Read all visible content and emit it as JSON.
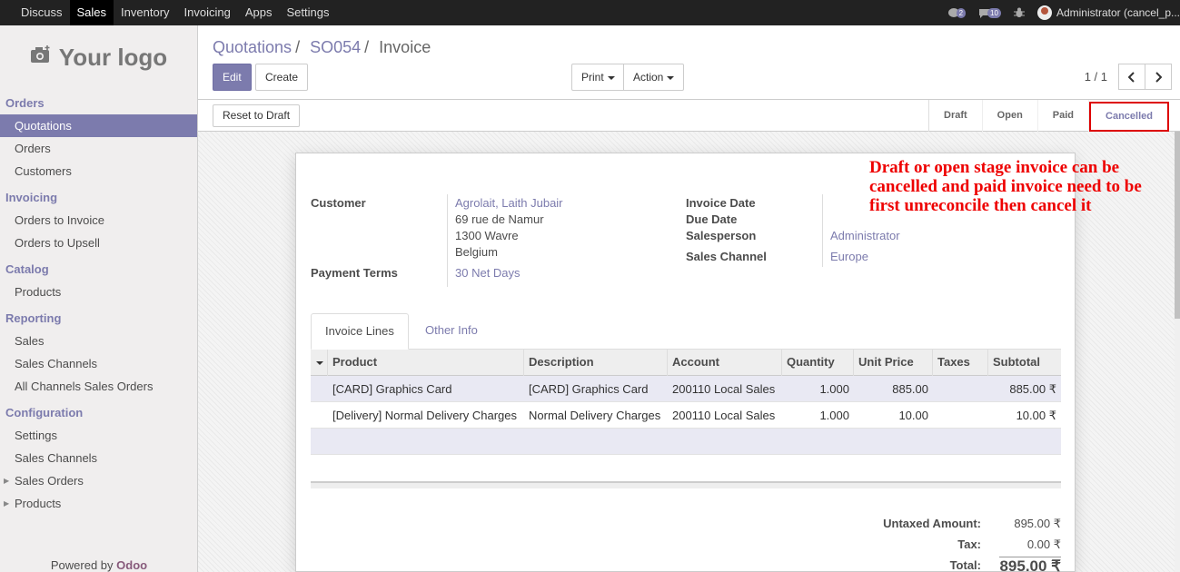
{
  "topbar": {
    "menu": [
      "Discuss",
      "Sales",
      "Inventory",
      "Invoicing",
      "Apps",
      "Settings"
    ],
    "active_menu": "Sales",
    "chat_count": "2",
    "activity_count": "10",
    "user": "Administrator (cancel_p..."
  },
  "sidebar": {
    "logo_text": "Your logo",
    "sections": [
      {
        "title": "Orders",
        "items": [
          "Quotations",
          "Orders",
          "Customers"
        ]
      },
      {
        "title": "Invoicing",
        "items": [
          "Orders to Invoice",
          "Orders to Upsell"
        ]
      },
      {
        "title": "Catalog",
        "items": [
          "Products"
        ]
      },
      {
        "title": "Reporting",
        "items": [
          "Sales",
          "Sales Channels",
          "All Channels Sales Orders"
        ]
      },
      {
        "title": "Configuration",
        "items": [
          "Settings",
          "Sales Channels",
          "Sales Orders",
          "Products"
        ]
      }
    ],
    "active_item": "Quotations",
    "powered_prefix": "Powered by",
    "powered_brand": "Odoo"
  },
  "breadcrumb": {
    "first": "Quotations",
    "second": "SO054",
    "current": "Invoice"
  },
  "buttons": {
    "edit": "Edit",
    "create": "Create",
    "print": "Print",
    "action": "Action",
    "reset": "Reset to Draft"
  },
  "pager": {
    "text": "1 / 1"
  },
  "stages": [
    "Draft",
    "Open",
    "Paid",
    "Cancelled"
  ],
  "active_stage": "Cancelled",
  "form": {
    "customer_label": "Customer",
    "customer_name": "Agrolait, Laith Jubair",
    "address_1": "69 rue de Namur",
    "address_2": "1300 Wavre",
    "address_3": "Belgium",
    "payment_terms_label": "Payment Terms",
    "payment_terms": "30 Net Days",
    "invoice_date_label": "Invoice Date",
    "due_date_label": "Due Date",
    "salesperson_label": "Salesperson",
    "salesperson": "Administrator",
    "sales_channel_label": "Sales Channel",
    "sales_channel": "Europe"
  },
  "annotation": "Draft or open stage invoice can be cancelled and paid invoice need to be first unreconcile then cancel it",
  "tabs": [
    "Invoice Lines",
    "Other Info"
  ],
  "table": {
    "headers": [
      "Product",
      "Description",
      "Account",
      "Quantity",
      "Unit Price",
      "Taxes",
      "Subtotal"
    ],
    "rows": [
      [
        "[CARD] Graphics Card",
        "[CARD] Graphics Card",
        "200110 Local Sales",
        "1.000",
        "885.00",
        "",
        "885.00 ₹"
      ],
      [
        "[Delivery] Normal Delivery Charges",
        "Normal Delivery Charges",
        "200110 Local Sales",
        "1.000",
        "10.00",
        "",
        "10.00 ₹"
      ]
    ]
  },
  "totals": {
    "untaxed_label": "Untaxed Amount:",
    "untaxed": "895.00 ₹",
    "tax_label": "Tax:",
    "tax": "0.00 ₹",
    "total_label": "Total:",
    "total": "895.00 ₹"
  }
}
